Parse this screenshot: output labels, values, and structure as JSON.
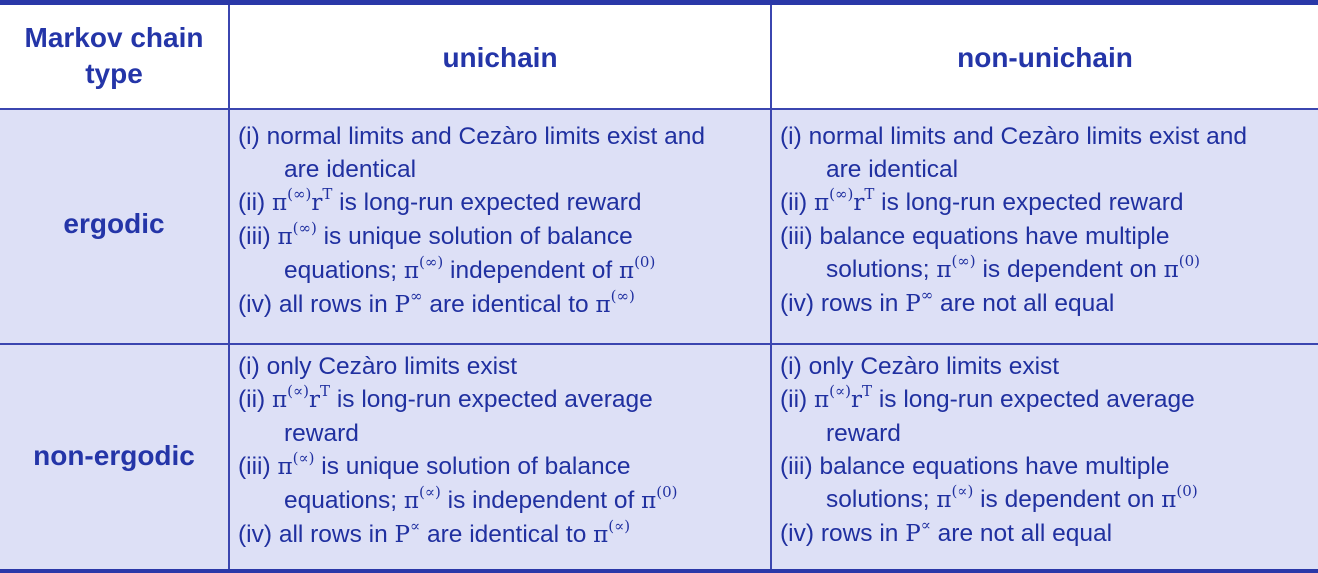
{
  "header": {
    "col0": [
      "Markov chain",
      "type"
    ],
    "col1": "unichain",
    "col2": "non-unichain"
  },
  "rows": [
    {
      "label": "ergodic",
      "unichain": [
        "(i) normal limits and Cezàro limits exist and",
        "are identical",
        "(ii) π(∞)rT is long-run expected reward",
        "(iii) π(∞) is unique solution of balance",
        "equations; π(∞) independent of π(0)",
        "(iv) all rows in P∞ are identical to π(∞)"
      ],
      "nonunichain": [
        "(i)  normal limits and Cezàro limits exist and",
        "are identical",
        "(ii) π(∞)rT is long-run expected reward",
        "(iii) balance equations have multiple",
        "solutions; π(∞) is dependent on π(0)",
        "(iv) rows in P∞ are not all equal"
      ]
    },
    {
      "label": "non-ergodic",
      "unichain": [
        "(i)   only Cezàro limits exist",
        "(ii)   π(∝)rT is long-run expected average",
        "reward",
        "(iii)  π(∝) is unique solution of balance",
        "equations; π(∝) is independent of π(0)",
        "(iv) all rows in P∝ are identical to π(∝)"
      ],
      "nonunichain": [
        "(i)   only Cezàro limits exist",
        "(ii)   π(∝)rT is long-run expected average",
        "reward",
        "(iii) balance equations have multiple",
        "solutions; π(∝) is dependent on π(0)",
        "(iv) rows in P∝ are not all equal"
      ]
    }
  ],
  "colors": {
    "accent": "#2435a8",
    "cell_fill": "#dde0f6",
    "border": "#3b46b0"
  }
}
